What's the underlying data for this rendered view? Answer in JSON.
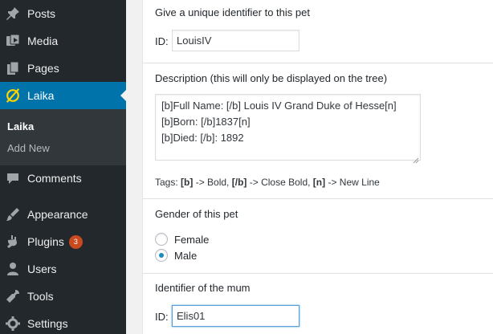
{
  "sidebar": {
    "items": [
      {
        "label": "Posts",
        "icon": "pushpin-icon"
      },
      {
        "label": "Media",
        "icon": "media-icon"
      },
      {
        "label": "Pages",
        "icon": "pages-icon"
      },
      {
        "label": "Laika",
        "icon": "laika-icon"
      },
      {
        "label": "Comments",
        "icon": "comments-icon"
      },
      {
        "label": "Appearance",
        "icon": "appearance-icon"
      },
      {
        "label": "Plugins",
        "icon": "plugins-icon",
        "badge": "3"
      },
      {
        "label": "Users",
        "icon": "users-icon"
      },
      {
        "label": "Tools",
        "icon": "tools-icon"
      },
      {
        "label": "Settings",
        "icon": "settings-icon"
      }
    ],
    "submenu": {
      "title": "Laika",
      "add_new": "Add New"
    },
    "colors": {
      "background": "#23282d",
      "active": "#0073aa",
      "submenu": "#32373c",
      "badge": "#ca4a1f",
      "laika_icon": "#ffd400"
    }
  },
  "form": {
    "identifier_label": "Give a unique identifier to this pet",
    "id_prefix": "ID:",
    "id_value": "LouisIV",
    "description_label": "Description (this will only be displayed on the tree)",
    "description_lines": [
      "[b]Full Name: [/b] Louis IV Grand Duke of Hesse[n]",
      "[b]Born: [/b]1837[n]",
      "[b]Died: [/b]: 1892"
    ],
    "tags": {
      "prefix": "Tags:",
      "bold_tag": "[b]",
      "bold_desc": "-> Bold,",
      "close_tag": "[/b]",
      "close_desc": "-> Close Bold,",
      "newline_tag": "[n]",
      "newline_desc": "-> New Line"
    },
    "gender_label": "Gender of this pet",
    "gender_options": [
      {
        "label": "Female",
        "checked": false
      },
      {
        "label": "Male",
        "checked": true
      }
    ],
    "mum_label": "Identifier of the mum",
    "mum_prefix": "ID:",
    "mum_value": "Elis01"
  }
}
